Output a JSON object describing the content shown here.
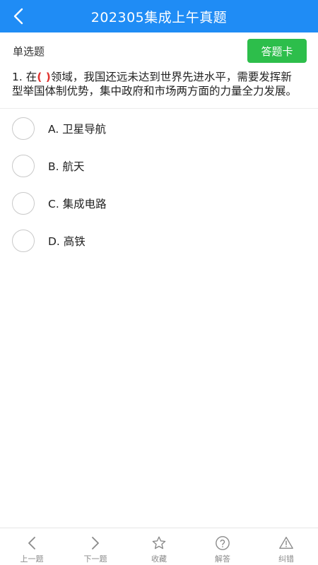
{
  "header": {
    "title": "202305集成上午真题",
    "back_icon": "chevron-left-icon",
    "background": "#1f8cf5"
  },
  "question_type": {
    "label": "单选题",
    "answer_card_label": "答题卡",
    "answer_card_color": "#2dbe4b"
  },
  "question": {
    "number": "1.",
    "prefix": "在",
    "blank": "( )",
    "text": "领域，我国还远未达到世界先进水平，需要发挥新型举国体制优势，集中政府和市场两方面的力量全力发展。"
  },
  "options": [
    {
      "label": "A. 卫星导航"
    },
    {
      "label": "B. 航天"
    },
    {
      "label": "C. 集成电路"
    },
    {
      "label": "D. 高铁"
    }
  ],
  "tabbar": {
    "items": [
      {
        "label": "上一题",
        "icon": "chevron-left-icon"
      },
      {
        "label": "下一题",
        "icon": "chevron-right-icon"
      },
      {
        "label": "收藏",
        "icon": "star-icon"
      },
      {
        "label": "解答",
        "icon": "question-circle-icon"
      },
      {
        "label": "纠错",
        "icon": "warning-triangle-icon"
      }
    ]
  }
}
